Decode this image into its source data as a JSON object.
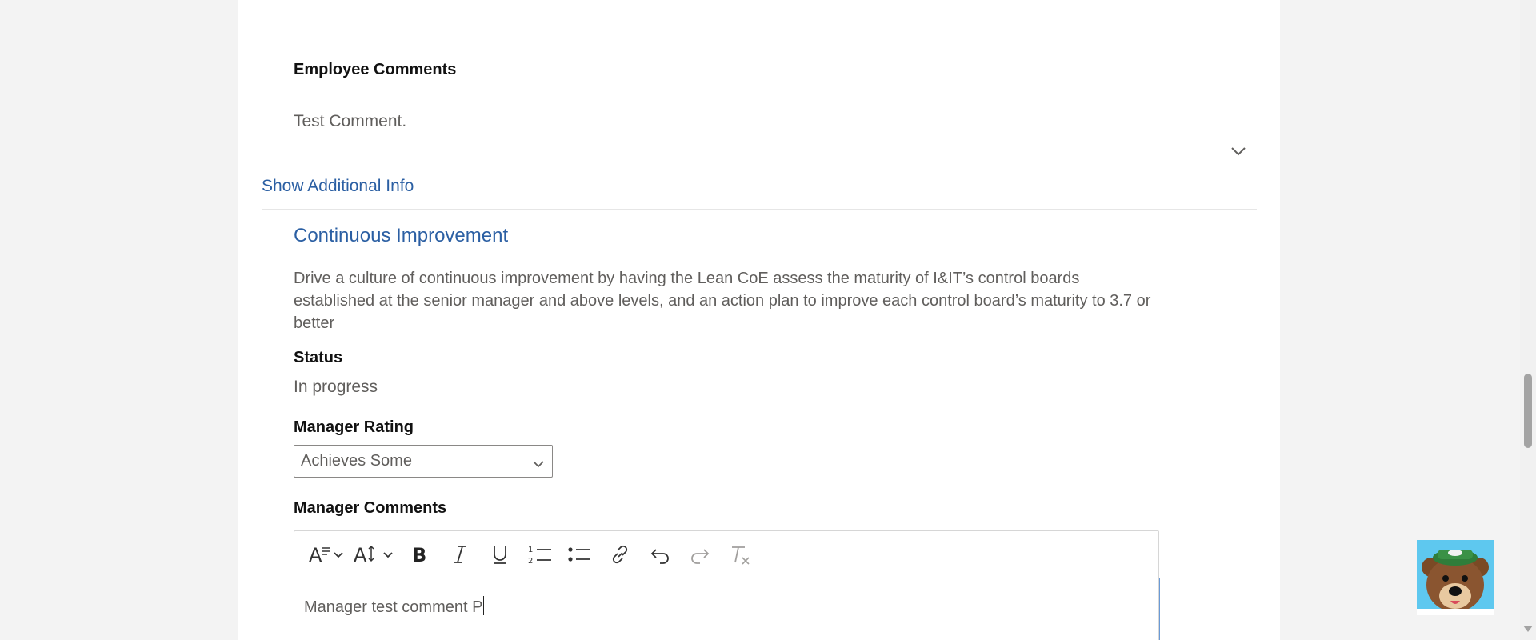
{
  "employee_comments": {
    "label": "Employee Comments",
    "value": "Test Comment."
  },
  "additional_info_link": "Show Additional Info",
  "goal": {
    "title": "Continuous Improvement",
    "description": "Drive a culture of continuous improvement by having the Lean CoE assess the maturity of I&IT’s control boards established at the senior manager and above levels, and an action plan to improve each control board’s maturity to 3.7 or better",
    "status_label": "Status",
    "status_value": "In progress",
    "rating_label": "Manager Rating",
    "rating_selected": "Achieves Some",
    "comments_label": "Manager Comments",
    "comments_value": "Manager test comment P"
  },
  "toolbar_icons": [
    "font-style-icon",
    "font-size-icon",
    "bold-icon",
    "italic-icon",
    "underline-icon",
    "numbered-list-icon",
    "bullet-list-icon",
    "link-icon",
    "undo-icon",
    "redo-icon",
    "clear-format-icon"
  ],
  "colors": {
    "link": "#2b5fa3",
    "muted_text": "#605e5c",
    "editor_focus_border": "#6a9ad6",
    "assistant_bg": "#5ec8ef"
  }
}
